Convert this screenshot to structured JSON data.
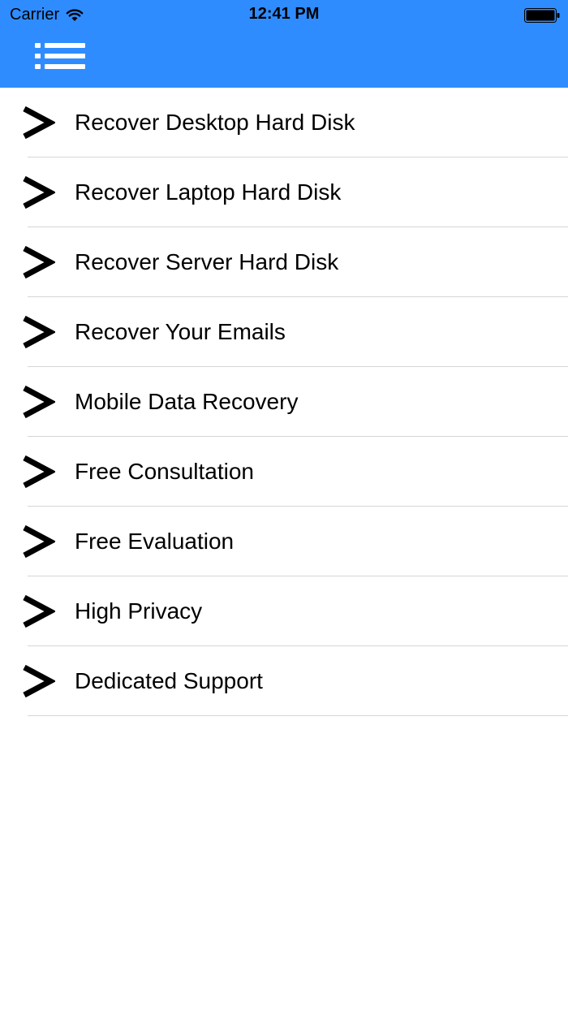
{
  "status_bar": {
    "carrier": "Carrier",
    "time": "12:41 PM",
    "wifi_icon": "wifi-icon",
    "battery_icon": "battery-icon"
  },
  "header": {
    "color": "#2f8cff",
    "menu_icon": "list-menu-icon"
  },
  "menu": {
    "chevron_icon": "chevron-right-icon",
    "items": [
      {
        "label": "Recover Desktop Hard Disk"
      },
      {
        "label": "Recover Laptop Hard Disk"
      },
      {
        "label": "Recover Server Hard Disk"
      },
      {
        "label": "Recover Your Emails"
      },
      {
        "label": "Mobile Data Recovery"
      },
      {
        "label": "Free Consultation"
      },
      {
        "label": "Free Evaluation"
      },
      {
        "label": "High Privacy"
      },
      {
        "label": "Dedicated Support"
      }
    ]
  }
}
